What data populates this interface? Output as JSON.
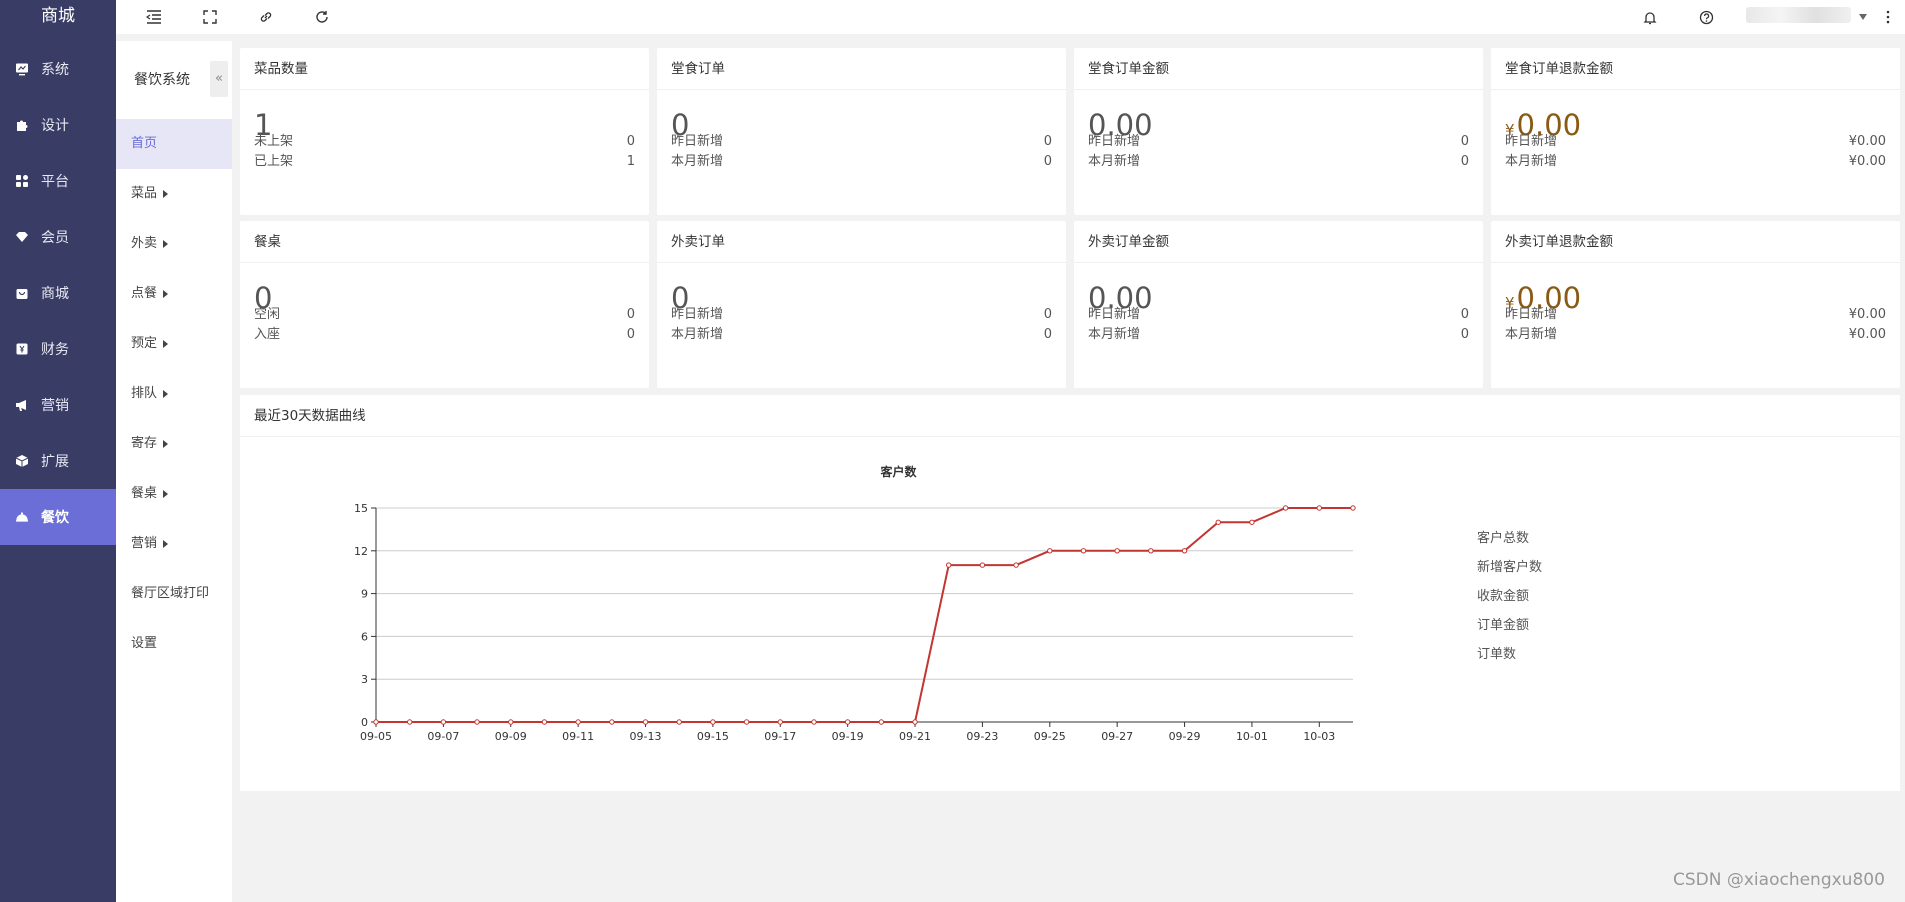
{
  "brand": "商城",
  "main_nav": [
    {
      "label": "系统",
      "icon": "monitor-icon"
    },
    {
      "label": "设计",
      "icon": "puzzle-icon"
    },
    {
      "label": "平台",
      "icon": "apps-icon"
    },
    {
      "label": "会员",
      "icon": "diamond-icon"
    },
    {
      "label": "商城",
      "icon": "bag-icon"
    },
    {
      "label": "财务",
      "icon": "yen-box-icon"
    },
    {
      "label": "营销",
      "icon": "megaphone-icon"
    },
    {
      "label": "扩展",
      "icon": "cube-icon"
    },
    {
      "label": "餐饮",
      "icon": "cloche-icon",
      "active": true
    }
  ],
  "sub_nav": {
    "title": "餐饮系统",
    "collapse_glyph": "«",
    "items": [
      {
        "label": "首页",
        "active": true,
        "has_children": false
      },
      {
        "label": "菜品",
        "has_children": true
      },
      {
        "label": "外卖",
        "has_children": true
      },
      {
        "label": "点餐",
        "has_children": true
      },
      {
        "label": "预定",
        "has_children": true
      },
      {
        "label": "排队",
        "has_children": true
      },
      {
        "label": "寄存",
        "has_children": true
      },
      {
        "label": "餐桌",
        "has_children": true
      },
      {
        "label": "营销",
        "has_children": true
      },
      {
        "label": "餐厅区域打印",
        "has_children": false
      },
      {
        "label": "设置",
        "has_children": false
      }
    ]
  },
  "topbar": {
    "left_icons": [
      "menu-fold-icon",
      "fullscreen-icon",
      "link-icon",
      "refresh-icon"
    ],
    "right_icons": [
      "bell-icon",
      "help-icon",
      "more-vertical-icon"
    ]
  },
  "cards": [
    {
      "title": "菜品数量",
      "big": "1",
      "money": false,
      "rows": [
        {
          "label": "未上架",
          "value": "0"
        },
        {
          "label": "已上架",
          "value": "1"
        }
      ]
    },
    {
      "title": "堂食订单",
      "big": "0",
      "money": false,
      "rows": [
        {
          "label": "昨日新增",
          "value": "0"
        },
        {
          "label": "本月新增",
          "value": "0"
        }
      ]
    },
    {
      "title": "堂食订单金额",
      "big": "0.00",
      "money": false,
      "rows": [
        {
          "label": "昨日新增",
          "value": "0"
        },
        {
          "label": "本月新增",
          "value": "0"
        }
      ]
    },
    {
      "title": "堂食订单退款金额",
      "big": "0.00",
      "money": true,
      "rows": [
        {
          "label": "昨日新增",
          "value": "¥0.00"
        },
        {
          "label": "本月新增",
          "value": "¥0.00"
        }
      ]
    },
    {
      "title": "餐桌",
      "big": "0",
      "money": false,
      "rows": [
        {
          "label": "空闲",
          "value": "0"
        },
        {
          "label": "入座",
          "value": "0"
        }
      ]
    },
    {
      "title": "外卖订单",
      "big": "0",
      "money": false,
      "rows": [
        {
          "label": "昨日新增",
          "value": "0"
        },
        {
          "label": "本月新增",
          "value": "0"
        }
      ]
    },
    {
      "title": "外卖订单金额",
      "big": "0.00",
      "money": false,
      "rows": [
        {
          "label": "昨日新增",
          "value": "0"
        },
        {
          "label": "本月新增",
          "value": "0"
        }
      ]
    },
    {
      "title": "外卖订单退款金额",
      "big": "0.00",
      "money": true,
      "rows": [
        {
          "label": "昨日新增",
          "value": "¥0.00"
        },
        {
          "label": "本月新增",
          "value": "¥0.00"
        }
      ]
    }
  ],
  "yen_symbol": "¥",
  "chart_section_title": "最近30天数据曲线",
  "chart_data": {
    "type": "line",
    "title": "客户数",
    "xlabel": "",
    "ylabel": "",
    "ylim": [
      0,
      15
    ],
    "yticks": [
      0,
      3,
      6,
      9,
      12,
      15
    ],
    "grid": true,
    "legend_position": "right",
    "x": [
      "09-05",
      "09-06",
      "09-07",
      "09-08",
      "09-09",
      "09-10",
      "09-11",
      "09-12",
      "09-13",
      "09-14",
      "09-15",
      "09-16",
      "09-17",
      "09-18",
      "09-19",
      "09-20",
      "09-21",
      "09-22",
      "09-23",
      "09-24",
      "09-25",
      "09-26",
      "09-27",
      "09-28",
      "09-29",
      "09-30",
      "10-01",
      "10-02",
      "10-03",
      "10-04"
    ],
    "xtick_labels": [
      "09-05",
      "09-07",
      "09-09",
      "09-11",
      "09-13",
      "09-15",
      "09-17",
      "09-19",
      "09-21",
      "09-23",
      "09-25",
      "09-27",
      "09-29",
      "10-01",
      "10-03"
    ],
    "series": [
      {
        "name": "客户总数",
        "color": "#c23531",
        "values": [
          0,
          0,
          0,
          0,
          0,
          0,
          0,
          0,
          0,
          0,
          0,
          0,
          0,
          0,
          0,
          0,
          0,
          11,
          11,
          11,
          12,
          12,
          12,
          12,
          12,
          14,
          14,
          15,
          15,
          15
        ]
      }
    ],
    "legend": [
      "客户总数",
      "新增客户数",
      "收款金额",
      "订单金额",
      "订单数"
    ]
  },
  "watermark": "CSDN @xiaochengxu800"
}
